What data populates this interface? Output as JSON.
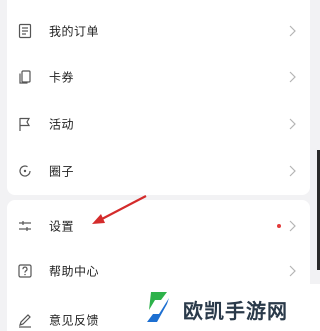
{
  "menu_group_1": [
    {
      "label": "我的订单",
      "icon": "order-list-icon"
    },
    {
      "label": "卡券",
      "icon": "coupon-icon"
    },
    {
      "label": "活动",
      "icon": "flag-icon"
    },
    {
      "label": "圈子",
      "icon": "circle-icon"
    }
  ],
  "menu_group_2": [
    {
      "label": "设置",
      "icon": "sliders-icon",
      "has_badge": true
    },
    {
      "label": "帮助中心",
      "icon": "help-icon"
    },
    {
      "label": "意见反馈",
      "icon": "pencil-icon"
    }
  ],
  "watermark": {
    "text": "欧凯手游网",
    "icon": "watermark-logo"
  },
  "colors": {
    "background": "#f2f2f4",
    "card": "#ffffff",
    "text": "#222222",
    "icon": "#555555",
    "chevron": "#b5b5b5",
    "badge": "#e23b3b",
    "annotation_arrow": "#d42b2b",
    "watermark_green": "#2db24a",
    "watermark_blue": "#1d6fd1"
  }
}
